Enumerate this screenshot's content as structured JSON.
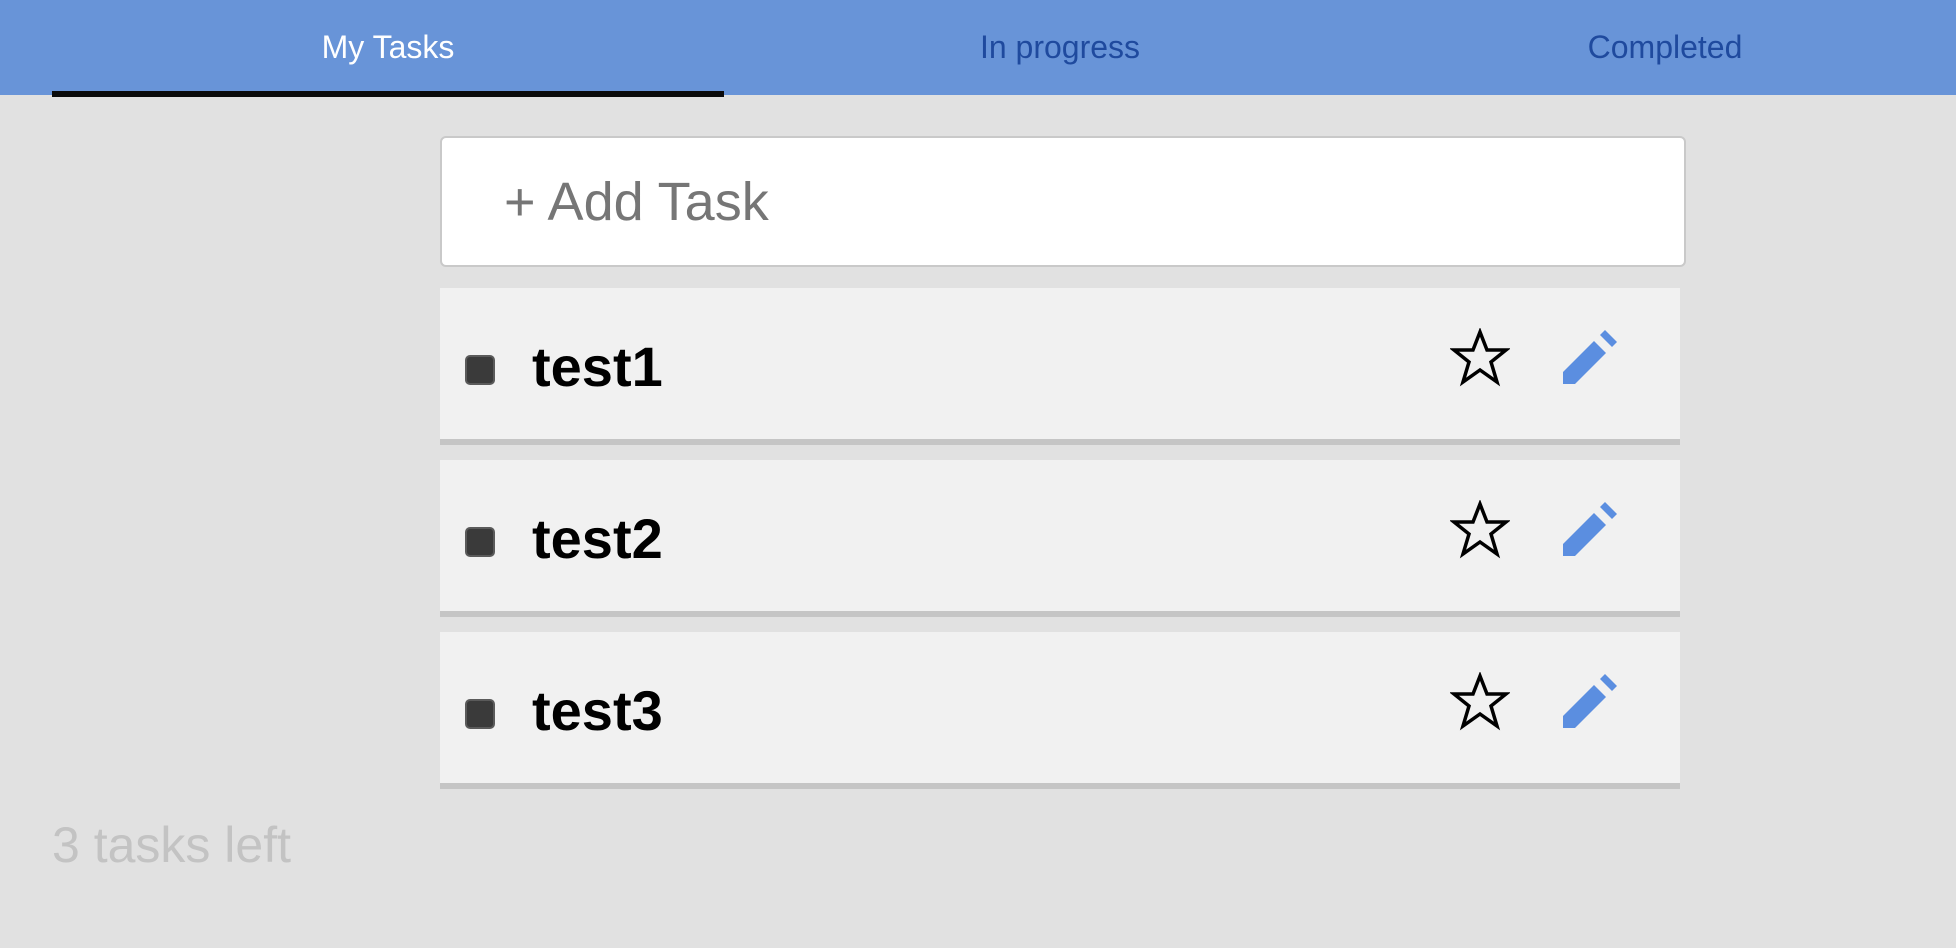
{
  "tabs": [
    {
      "label": "My Tasks",
      "active": true
    },
    {
      "label": "In progress",
      "active": false
    },
    {
      "label": "Completed",
      "active": false
    }
  ],
  "add_task": {
    "placeholder": "+ Add Task"
  },
  "tasks": [
    {
      "name": "test1",
      "icons": [
        "checkbox",
        "star-icon",
        "pencil-icon"
      ]
    },
    {
      "name": "test2",
      "icons": [
        "checkbox",
        "star-icon",
        "pencil-icon"
      ]
    },
    {
      "name": "test3",
      "icons": [
        "checkbox",
        "star-icon",
        "pencil-icon"
      ]
    }
  ],
  "footer": {
    "tasks_left": "3 tasks left"
  },
  "colors": {
    "header": "#6894d8",
    "active_tab_text": "#ffffff",
    "inactive_tab_text": "#1f4a9e",
    "underline": "#0b0b0b",
    "background": "#e1e1e1",
    "task_bg": "#f1f1f1",
    "pencil": "#5b8ee0"
  }
}
